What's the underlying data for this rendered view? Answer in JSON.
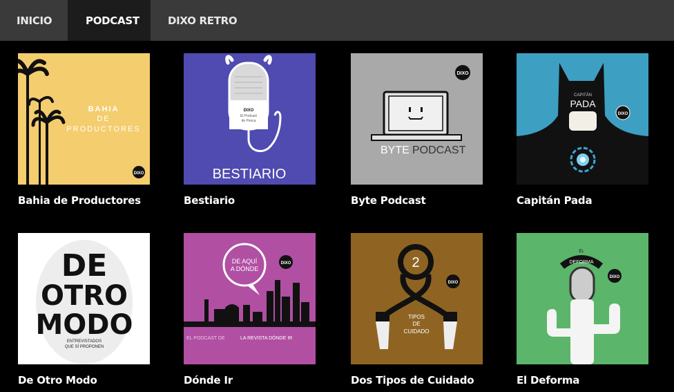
{
  "nav": {
    "tabs": [
      {
        "label": "INICIO",
        "active": false
      },
      {
        "label": "PODCAST",
        "active": true
      },
      {
        "label": "DIXO RETRO",
        "active": false
      }
    ]
  },
  "podcasts": [
    {
      "title": "Bahia de Productores",
      "cover_lines": [
        "BAHIA",
        "DE",
        "PRODUCTORES"
      ],
      "cover_color": "#f4cd6e",
      "logo": "DIXO"
    },
    {
      "title": "Bestiario",
      "cover_text": "BESTIARIO",
      "cover_small": [
        "DIXO",
        "El Podcast",
        "de Pesca"
      ],
      "cover_color": "#4f4bb0"
    },
    {
      "title": "Byte Podcast",
      "cover_text_a": "BYTE",
      "cover_text_b": "PODCAST",
      "cover_color": "#a9a9a9",
      "logo": "DIXO"
    },
    {
      "title": "Capitán Pada",
      "cover_small": "CAPITÁN",
      "cover_text": "PADA",
      "cover_color": "#3d9fc2",
      "logo": "DIXO"
    },
    {
      "title": "De Otro Modo",
      "cover_lines": [
        "DE",
        "OTRO",
        "MODO"
      ],
      "cover_small": [
        "ENTREVISTADOS",
        "QUE SÍ PROPONEN"
      ],
      "cover_color": "#ffffff"
    },
    {
      "title": "Dónde Ir",
      "cover_bubble": [
        "DE AQUÍ",
        "A DÓNDE"
      ],
      "cover_footer_a": "EL PODCAST DE",
      "cover_footer_b": "LA REVISTA DÓNDE IR",
      "cover_color": "#b14fa3",
      "logo": "DIXO"
    },
    {
      "title": "Dos Tipos de Cuidado",
      "cover_number": "2",
      "cover_lines": [
        "TIPOS",
        "DE",
        "CUIDADO"
      ],
      "cover_color": "#8f6422",
      "logo": "DIXO"
    },
    {
      "title": "El Deforma",
      "cover_small": "EL",
      "cover_text": "DEFORMA",
      "cover_color": "#5bb56a",
      "logo": "DIXO"
    }
  ]
}
